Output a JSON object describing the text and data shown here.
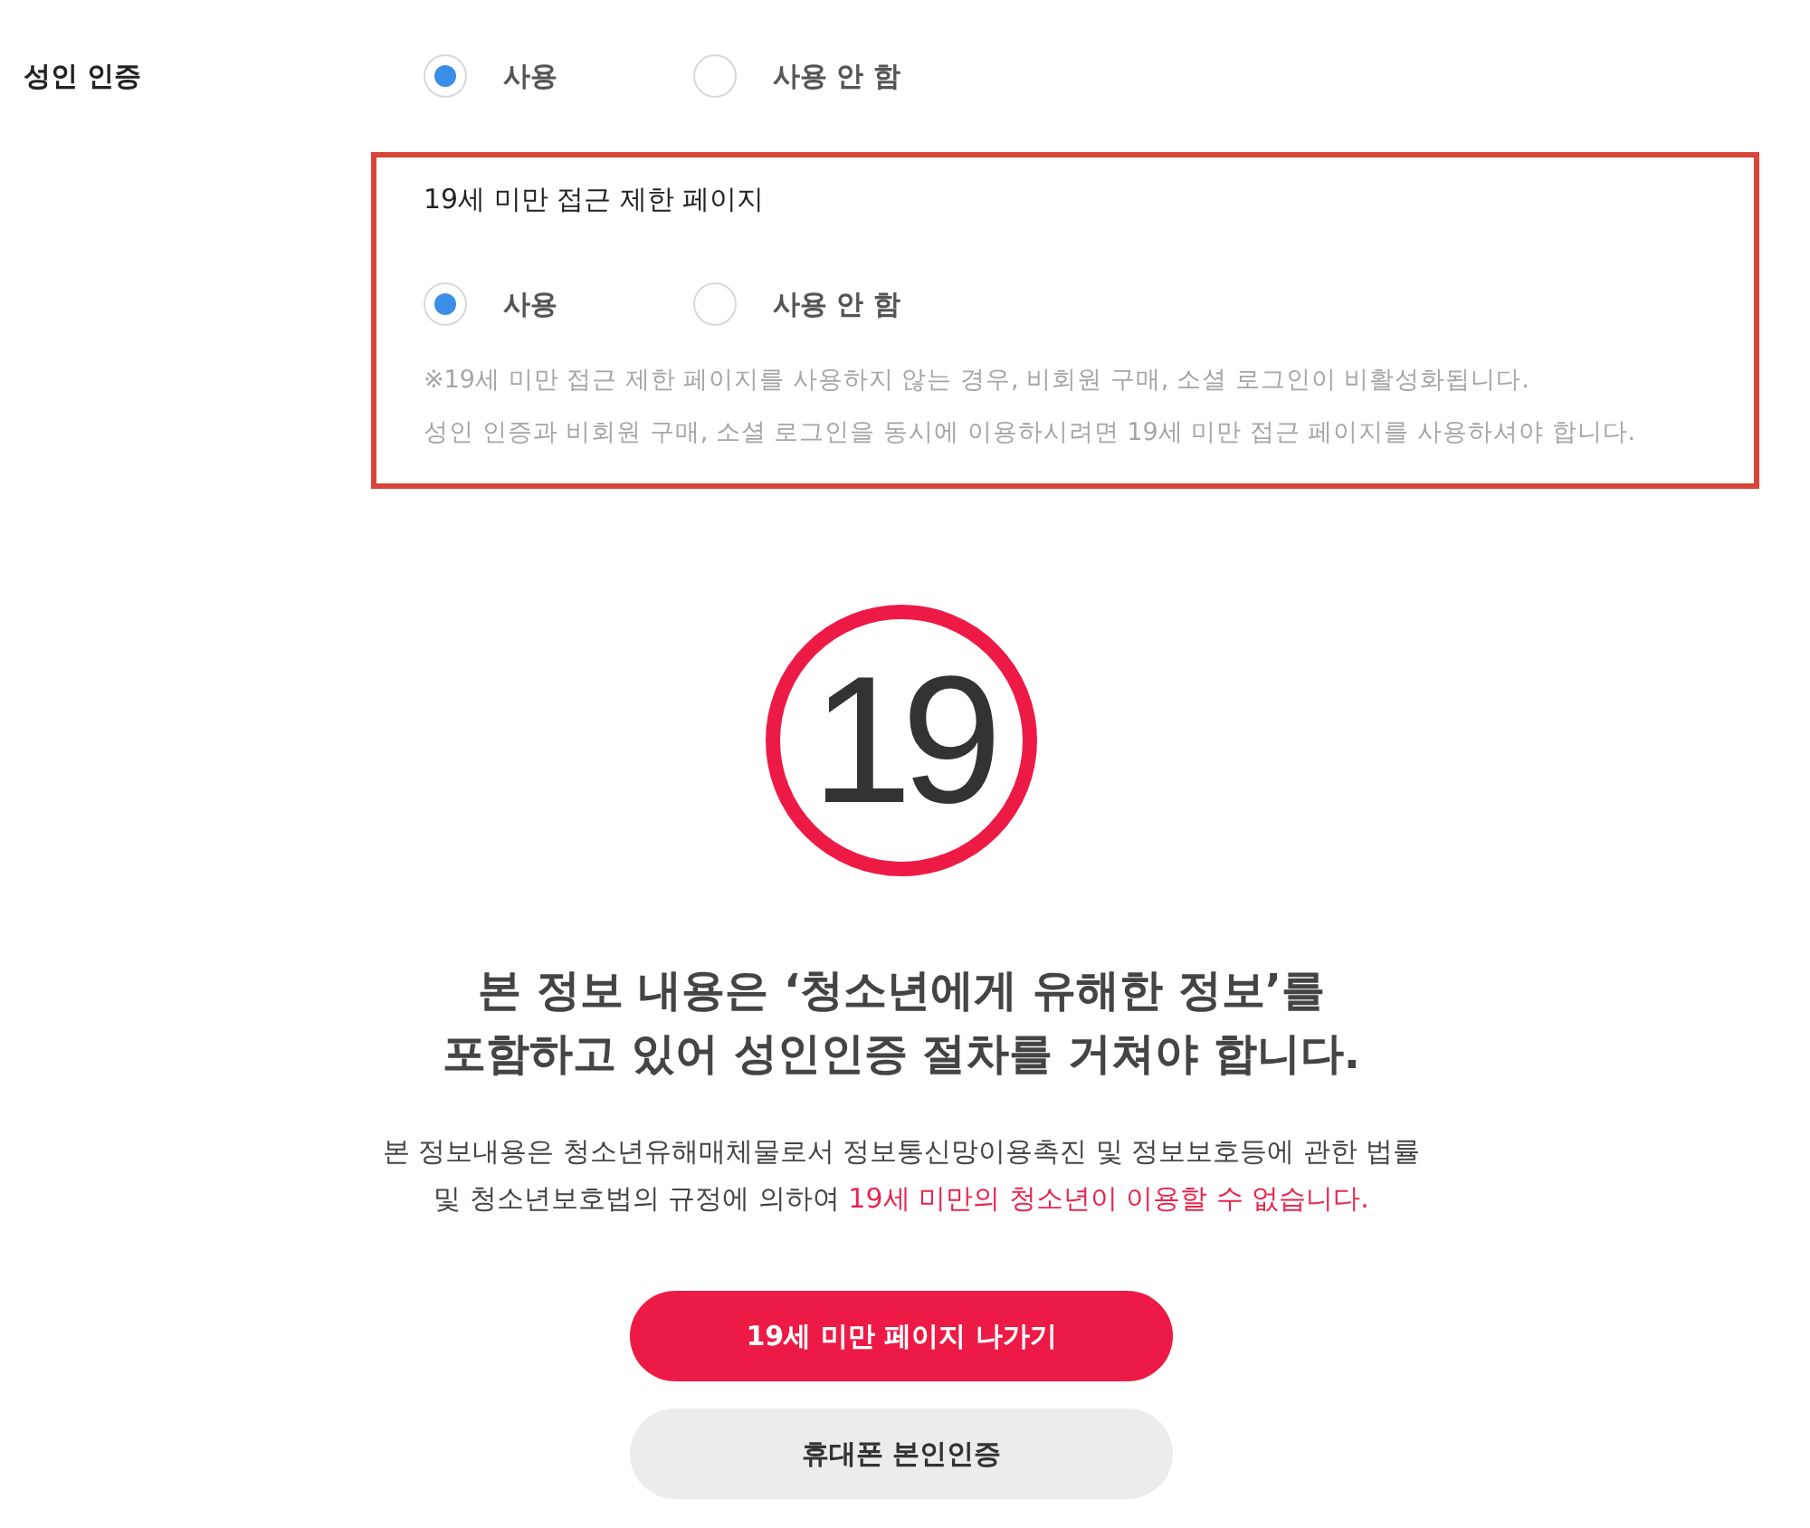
{
  "adult_verification": {
    "label": "성인 인증",
    "options": [
      {
        "label": "사용",
        "selected": true
      },
      {
        "label": "사용 안 함",
        "selected": false
      }
    ]
  },
  "restricted_page": {
    "title": "19세 미만 접근 제한 페이지",
    "options": [
      {
        "label": "사용",
        "selected": true
      },
      {
        "label": "사용 안 함",
        "selected": false
      }
    ],
    "notes": [
      "※19세 미만 접근 제한 페이지를 사용하지 않는 경우, 비회원 구매, 소셜 로그인이 비활성화됩니다.",
      "성인 인증과 비회원 구매, 소셜 로그인을 동시에 이용하시려면 19세 미만 접근 페이지를 사용하셔야 합니다."
    ]
  },
  "notice": {
    "badge": "19",
    "heading": "본 정보 내용은 ‘청소년에게 유해한 정보’를\n포함하고 있어 성인인증 절차를 거쳐야 합니다.",
    "body": {
      "text": "본 정보내용은 청소년유해매체물로서 정보통신망이용촉진 및 정보보호등에 관한 법률\n및 청소년보호법의 규정에 의하여 ",
      "highlight": "19세 미만의 청소년이 이용할 수 없습니다."
    }
  },
  "buttons": [
    {
      "label": "19세 미만 페이지 나가기",
      "kind": "primary"
    },
    {
      "label": "휴대폰 본인인증",
      "kind": "secondary"
    }
  ]
}
